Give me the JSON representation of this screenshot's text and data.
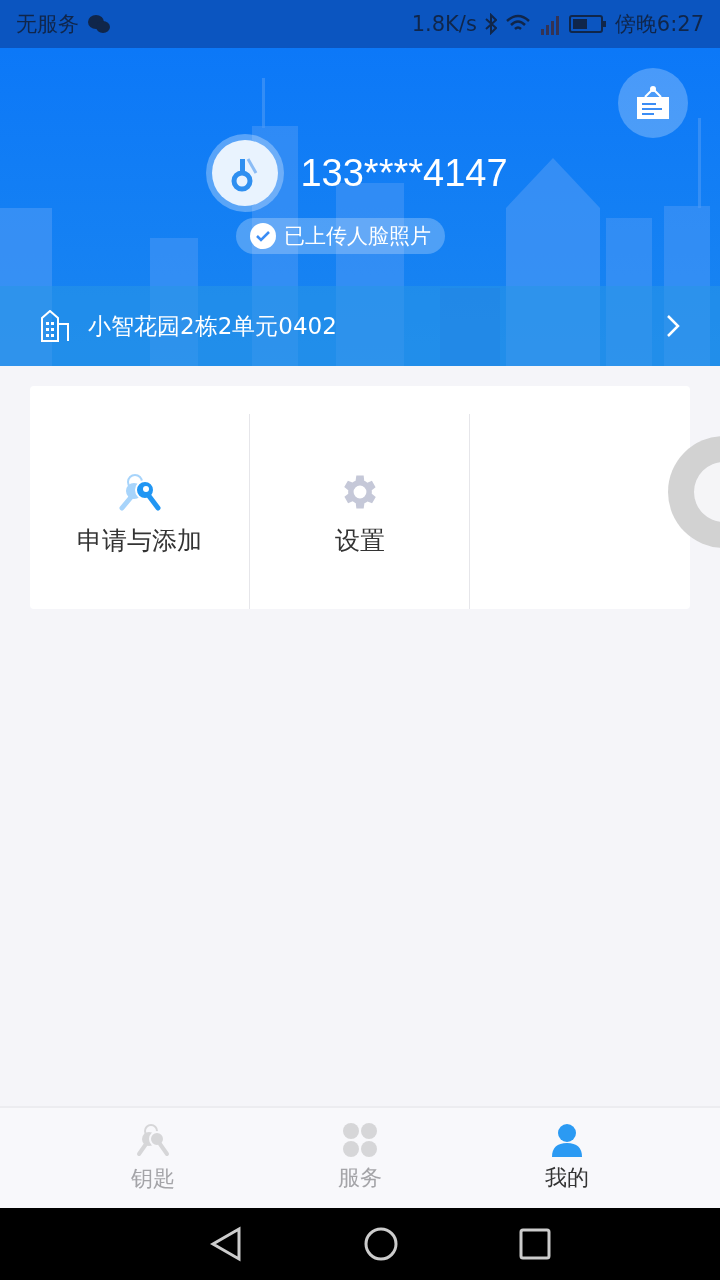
{
  "status_bar": {
    "carrier": "无服务",
    "speed": "1.8K/s",
    "time": "傍晚6:27"
  },
  "profile": {
    "phone": "133****4147",
    "face_badge": "已上传人脸照片",
    "address": "小智花园2栋2单元0402"
  },
  "menu": [
    {
      "kind": "keys",
      "label": "申请与添加"
    },
    {
      "kind": "settings",
      "label": "设置"
    },
    {
      "kind": "empty"
    }
  ],
  "tabs": [
    {
      "kind": "keys",
      "label": "钥匙",
      "selected": false
    },
    {
      "kind": "services",
      "label": "服务",
      "selected": false
    },
    {
      "kind": "me",
      "label": "我的",
      "selected": true
    }
  ]
}
